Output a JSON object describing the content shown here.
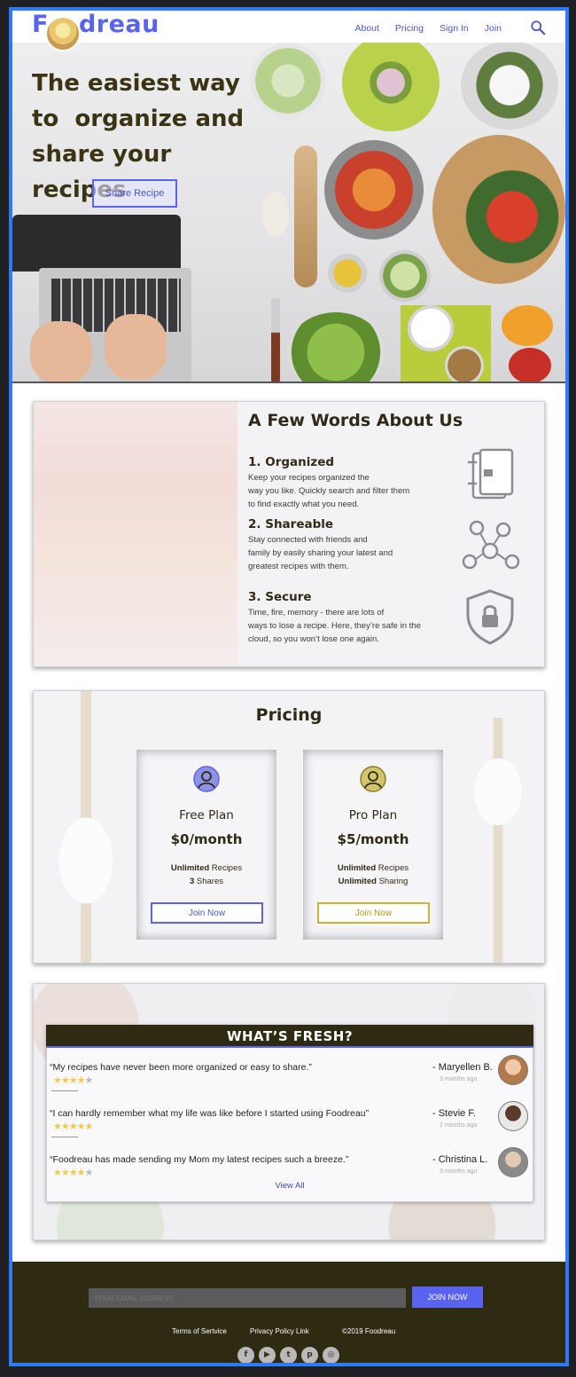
{
  "nav": {
    "logo_text_before": "F",
    "logo_text_after": "dreau",
    "links": [
      "About",
      "Pricing",
      "Sign In",
      "Join"
    ],
    "search_icon": "search-icon"
  },
  "hero": {
    "title_line1": "The easiest way",
    "title_line2": "to  organize and",
    "title_line3": "share your recipes",
    "cta": "Share Recipe"
  },
  "about": {
    "title": "A Few Words About Us",
    "features": [
      {
        "title": "1. Organized",
        "lines": [
          "Keep your recipes organized the",
          "way you like. Quickly search and filter them",
          "to find exactly what you need."
        ],
        "icon": "book-icon"
      },
      {
        "title": "2. Shareable",
        "lines": [
          "Stay connected with friends and",
          "family by easily sharing your latest and",
          "greatest recipes with them."
        ],
        "icon": "network-icon"
      },
      {
        "title": "3. Secure",
        "lines": [
          "Time, fire, memory - there are lots of",
          "ways to lose a recipe. Here, they’re safe in the",
          "cloud, so you won’t lose one again."
        ],
        "icon": "shield-lock-icon"
      }
    ]
  },
  "pricing": {
    "title": "Pricing",
    "plans": [
      {
        "name": "Free Plan",
        "price": "$0/month",
        "line1_bold": "Unlimited",
        "line1_rest": " Recipes",
        "line2_bold": "3",
        "line2_rest": " Shares",
        "button": "Join Now",
        "accent": "#5a63f0"
      },
      {
        "name": "Pro Plan",
        "price": "$5/month",
        "line1_bold": "Unlimited",
        "line1_rest": " Recipes",
        "line2_bold": "Unlimited",
        "line2_rest": " Sharing",
        "button": "Join Now",
        "accent": "#c9b435"
      }
    ]
  },
  "fresh": {
    "title": "WHAT’S FRESH?",
    "reviews": [
      {
        "quote": "“My recipes have never been more organized or easy to share.”",
        "author": "- Maryellen B.",
        "time": "3 months ago",
        "stars": 4
      },
      {
        "quote": "“I can hardly remember what my life  was like before I started using Foodreau”",
        "author": "- Stevie F.",
        "time": "2 months ago",
        "stars": 5
      },
      {
        "quote": "“Foodreau has made sending my Mom my latest recipes such a breeze.”",
        "author": "- Christina L.",
        "time": "3 months ago",
        "stars": 4
      }
    ],
    "view_all": "View All"
  },
  "footer": {
    "email_placeholder": "YOUR EMAIL ADDRESS",
    "join_button": "JOIN NOW",
    "terms": "Terms of Sertvice",
    "privacy": "Privacy Policy Link",
    "copyright": "©2019 Foodreau",
    "socials": [
      "facebook-icon",
      "youtube-icon",
      "twitter-icon",
      "pinterest-icon",
      "instagram-icon"
    ]
  },
  "colors": {
    "brand": "#5a63f0",
    "dark": "#2f2a12",
    "frame": "#2f7bf5",
    "gold": "#c9b435"
  }
}
